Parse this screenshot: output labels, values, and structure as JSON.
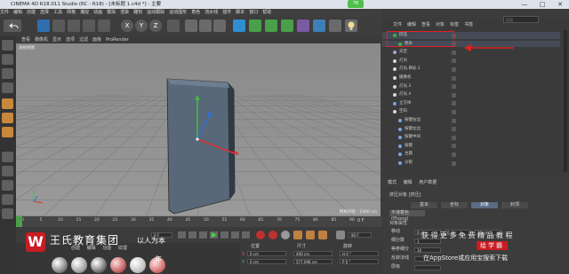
{
  "window": {
    "title": "CINEMA 4D R18.011 Studio (RC - R18) - [未标题 1.c4d *] - 主要",
    "badge": "76",
    "minimize": "—",
    "maximize": "□",
    "close": "✕"
  },
  "menubar": [
    "文件",
    "编辑",
    "创建",
    "选择",
    "工具",
    "网格",
    "捕捉",
    "动画",
    "模拟",
    "渲染",
    "雕刻",
    "运动跟踪",
    "运动图形",
    "角色",
    "流水线",
    "插件",
    "脚本",
    "窗口",
    "帮助"
  ],
  "toolbar": {
    "axis_buttons": [
      "X",
      "Y",
      "Z"
    ]
  },
  "viewport": {
    "menu": [
      "查看",
      "摄像机",
      "显示",
      "选项",
      "过滤",
      "面板",
      "ProRender"
    ],
    "label": "透视视图",
    "grid_info": "网格间距 : 1000 cm"
  },
  "timeline": {
    "ticks": [
      "0",
      "5",
      "10",
      "15",
      "20",
      "25",
      "30",
      "35",
      "40",
      "45",
      "50",
      "55",
      "60",
      "65",
      "70",
      "75",
      "80",
      "85",
      "90"
    ],
    "current_frame": "0 F",
    "start_field": "0 F",
    "end_field": "90 F",
    "end_label": "0 F"
  },
  "materials": {
    "menu": [
      "创建",
      "编辑",
      "功能",
      "纹理"
    ]
  },
  "coords": {
    "headers": [
      "位置",
      "尺寸",
      "旋转"
    ],
    "rows": [
      {
        "pos": "0 cm",
        "size": "400 cm",
        "rot": "H 0 °"
      },
      {
        "pos": "0 cm",
        "size": "577.096 cm",
        "rot": "P 0 °"
      }
    ]
  },
  "object_manager": {
    "menu": [
      "文件",
      "编辑",
      "查看",
      "对象",
      "标签",
      "书签"
    ],
    "search_placeholder": "两级",
    "objects": [
      {
        "name": "挤压",
        "color": "#3fae3f",
        "indent": 1,
        "selected": true
      },
      {
        "name": "矩形",
        "color": "#3fae3f",
        "indent": 2,
        "selected": true
      },
      {
        "name": "天空",
        "color": "#9aa7d8",
        "indent": 1,
        "selected": false
      },
      {
        "name": "灯光",
        "color": "#d8d8d8",
        "indent": 1,
        "selected": false
      },
      {
        "name": "灯光.目标.1",
        "color": "#d8d8d8",
        "indent": 1,
        "selected": false
      },
      {
        "name": "摄像机",
        "color": "#d8d8d8",
        "indent": 1,
        "selected": false
      },
      {
        "name": "灯光.3",
        "color": "#d8d8d8",
        "indent": 1,
        "selected": false
      },
      {
        "name": "灯光.4",
        "color": "#d8d8d8",
        "indent": 1,
        "selected": false
      },
      {
        "name": "立方体",
        "color": "#7aa6e0",
        "indent": 1,
        "selected": false
      },
      {
        "name": "空白",
        "color": "#d8d8d8",
        "indent": 1,
        "selected": false
      },
      {
        "name": "按键右边",
        "color": "#7aa6e0",
        "indent": 2,
        "selected": false
      },
      {
        "name": "按键左边",
        "color": "#7aa6e0",
        "indent": 2,
        "selected": false
      },
      {
        "name": "按键中间",
        "color": "#7aa6e0",
        "indent": 2,
        "selected": false
      },
      {
        "name": "按键",
        "color": "#7aa6e0",
        "indent": 2,
        "selected": false
      },
      {
        "name": "主题",
        "color": "#7aa6e0",
        "indent": 2,
        "selected": false
      },
      {
        "name": "分裂",
        "color": "#7aa6e0",
        "indent": 2,
        "selected": false
      }
    ]
  },
  "attributes": {
    "tabs": [
      "模式",
      "编辑",
      "用户数据"
    ],
    "title": "挤压对象 [挤压]",
    "subtabs": [
      "基本",
      "坐标",
      "对象",
      "封顶"
    ],
    "active_subtab": "对象",
    "phong": "平滑着色(Phong)",
    "section": "对象属性",
    "rows": [
      {
        "label": "移动",
        "v1": "0 cm",
        "v2": "0 cm",
        "v3": "30 cm"
      },
      {
        "label": "细分数",
        "v1": "1",
        "v2": "",
        "v3": ""
      },
      {
        "label": "等参细分",
        "v1": "10",
        "v2": "",
        "v3": ""
      },
      {
        "label": "反转法线",
        "v1": "",
        "v2": "",
        "v3": ""
      },
      {
        "label": "层级",
        "v1": "",
        "v2": "",
        "v3": ""
      }
    ]
  },
  "overlay": {
    "logo_letter": "W",
    "brand_name": "王氏教育集团",
    "brand_sub": "以人为本",
    "year_text": "年",
    "promo_line1": "获得更多免费精品教程",
    "promo_highlight": "给学霸",
    "promo_line3": "在AppStore或应用宝搜索下载"
  },
  "colors": {
    "accent_green": "#3fae3f",
    "selection_red": "#e02020",
    "brand_red": "#c91c23"
  }
}
